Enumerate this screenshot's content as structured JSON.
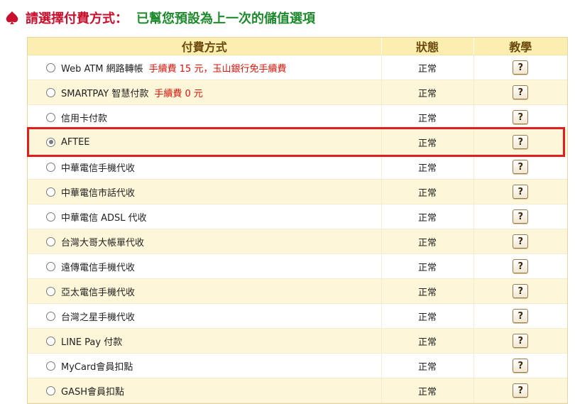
{
  "header": {
    "label": "請選擇付費方式：",
    "note": "已幫您預設為上一次的儲值選項"
  },
  "table": {
    "headers": [
      "付費方式",
      "狀態",
      "教學"
    ],
    "help_glyph": "?",
    "rows": [
      {
        "name": "Web ATM 網路轉帳",
        "fee": "手續費 15 元，玉山銀行免手續費",
        "status": "正常",
        "selected": false
      },
      {
        "name": "SMARTPAY 智慧付款",
        "fee": "手續費 0 元",
        "status": "正常",
        "selected": false
      },
      {
        "name": "信用卡付款",
        "fee": "",
        "status": "正常",
        "selected": false
      },
      {
        "name": "AFTEE",
        "fee": "",
        "status": "正常",
        "selected": true
      },
      {
        "name": "中華電信手機代收",
        "fee": "",
        "status": "正常",
        "selected": false
      },
      {
        "name": "中華電信市話代收",
        "fee": "",
        "status": "正常",
        "selected": false
      },
      {
        "name": "中華電信 ADSL 代收",
        "fee": "",
        "status": "正常",
        "selected": false
      },
      {
        "name": "台灣大哥大帳單代收",
        "fee": "",
        "status": "正常",
        "selected": false
      },
      {
        "name": "遠傳電信手機代收",
        "fee": "",
        "status": "正常",
        "selected": false
      },
      {
        "name": "亞太電信手機代收",
        "fee": "",
        "status": "正常",
        "selected": false
      },
      {
        "name": "台灣之星手機代收",
        "fee": "",
        "status": "正常",
        "selected": false
      },
      {
        "name": "LINE Pay 付款",
        "fee": "",
        "status": "正常",
        "selected": false
      },
      {
        "name": "MyCard會員扣點",
        "fee": "",
        "status": "正常",
        "selected": false
      },
      {
        "name": "GASH會員扣點",
        "fee": "",
        "status": "正常",
        "selected": false
      }
    ]
  },
  "colors": {
    "label": "#c8102e",
    "note": "#1f8a2e",
    "header_bg": "#fbeeb0",
    "row_alt_bg": "#fdf6d8",
    "fee_text": "#d4140a",
    "highlight_border": "#e01e1e"
  },
  "icons": {
    "header_marker": "spade-icon",
    "help": "question-mark-icon",
    "radio": "radio-icon"
  }
}
